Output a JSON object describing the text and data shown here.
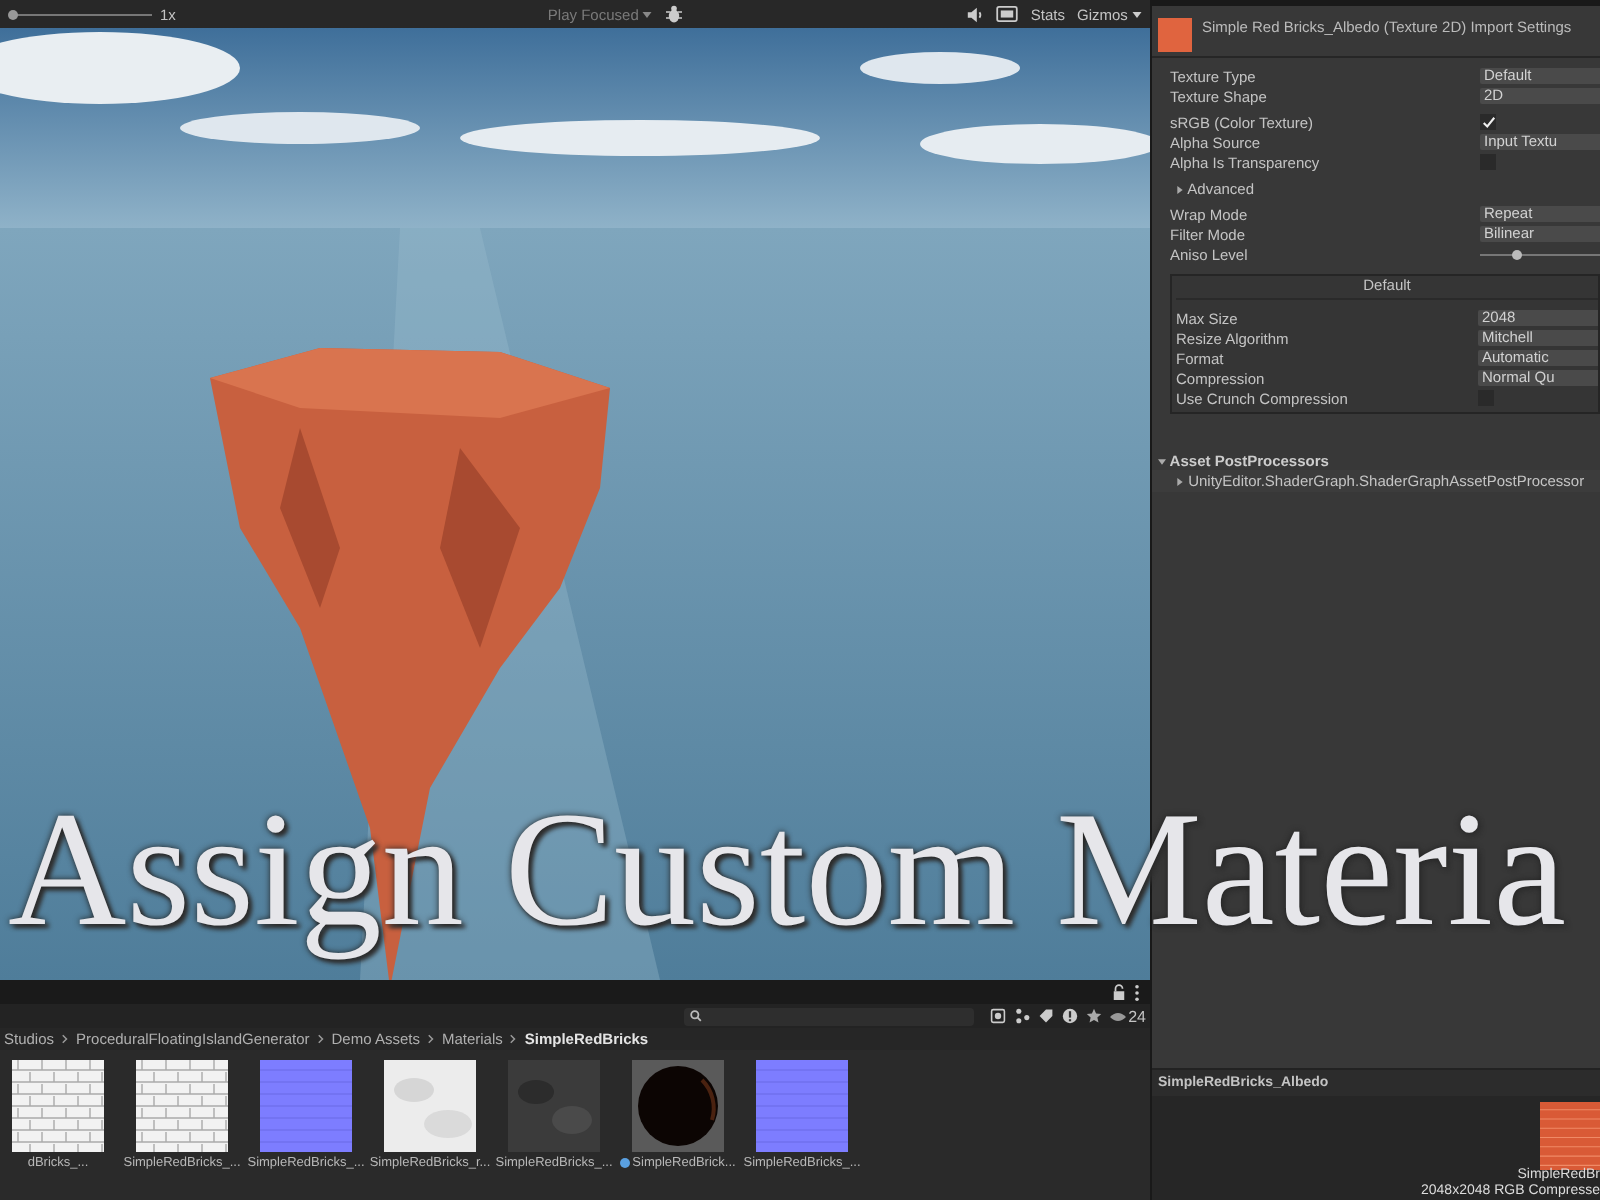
{
  "scene_toolbar": {
    "speed_label": "1x",
    "speed_slider": {
      "level": 0
    },
    "play_mode": "Play Focused",
    "stats": "Stats",
    "gizmos": "Gizmos"
  },
  "overlay_title": "Assign Custom Materia",
  "inspector": {
    "title": "Simple Red Bricks_Albedo (Texture 2D) Import Settings",
    "groups": [
      [
        {
          "label": "Texture Type",
          "kind": "dropdown",
          "value": "Default"
        },
        {
          "label": "Texture Shape",
          "kind": "dropdown",
          "value": "2D"
        }
      ],
      [
        {
          "label": "sRGB (Color Texture)",
          "kind": "checkbox",
          "checked": true
        },
        {
          "label": "Alpha Source",
          "kind": "dropdown",
          "value": "Input Textu"
        },
        {
          "label": "Alpha Is Transparency",
          "kind": "checkbox",
          "checked": false
        }
      ],
      [
        {
          "label": "Advanced",
          "kind": "foldout",
          "expanded": false
        }
      ],
      [
        {
          "label": "Wrap Mode",
          "kind": "dropdown",
          "value": "Repeat"
        },
        {
          "label": "Filter Mode",
          "kind": "dropdown",
          "value": "Bilinear"
        },
        {
          "label": "Aniso Level",
          "kind": "slider",
          "level": 0.3
        }
      ]
    ],
    "platform": {
      "title": "Default",
      "rows": [
        {
          "label": "Max Size",
          "kind": "dropdown",
          "value": "2048"
        },
        {
          "label": "Resize Algorithm",
          "kind": "dropdown",
          "value": "Mitchell"
        },
        {
          "label": "Format",
          "kind": "dropdown",
          "value": "Automatic"
        },
        {
          "label": "Compression",
          "kind": "dropdown",
          "value": "Normal Qu"
        },
        {
          "label": "Use Crunch Compression",
          "kind": "checkbox",
          "checked": false
        }
      ]
    },
    "postprocessors": {
      "title": "Asset PostProcessors",
      "expanded": true,
      "items": [
        {
          "label": "UnityEditor.ShaderGraph.ShaderGraphAssetPostProcessor",
          "expanded": false
        }
      ]
    }
  },
  "project": {
    "visible_count": "24",
    "breadcrumb": [
      {
        "label": "Studios",
        "selected": false
      },
      {
        "label": "ProceduralFloatingIslandGenerator",
        "selected": false
      },
      {
        "label": "Demo Assets",
        "selected": false
      },
      {
        "label": "Materials",
        "selected": false
      },
      {
        "label": "SimpleRedBricks",
        "selected": true
      }
    ],
    "assets": [
      {
        "name": "dBricks_...",
        "kind": "bricks-light"
      },
      {
        "name": "SimpleRedBricks_...",
        "kind": "bricks-light"
      },
      {
        "name": "SimpleRedBricks_...",
        "kind": "normal-map"
      },
      {
        "name": "SimpleRedBricks_r...",
        "kind": "noise-light"
      },
      {
        "name": "SimpleRedBricks_...",
        "kind": "noise-dark"
      },
      {
        "name": "SimpleRedBrick...",
        "kind": "material"
      },
      {
        "name": "SimpleRedBricks_...",
        "kind": "normal-map"
      }
    ]
  },
  "preview": {
    "title": "SimpleRedBricks_Albedo",
    "name": "SimpleRedBr",
    "info": "2048x2048  RGB Compresse"
  }
}
